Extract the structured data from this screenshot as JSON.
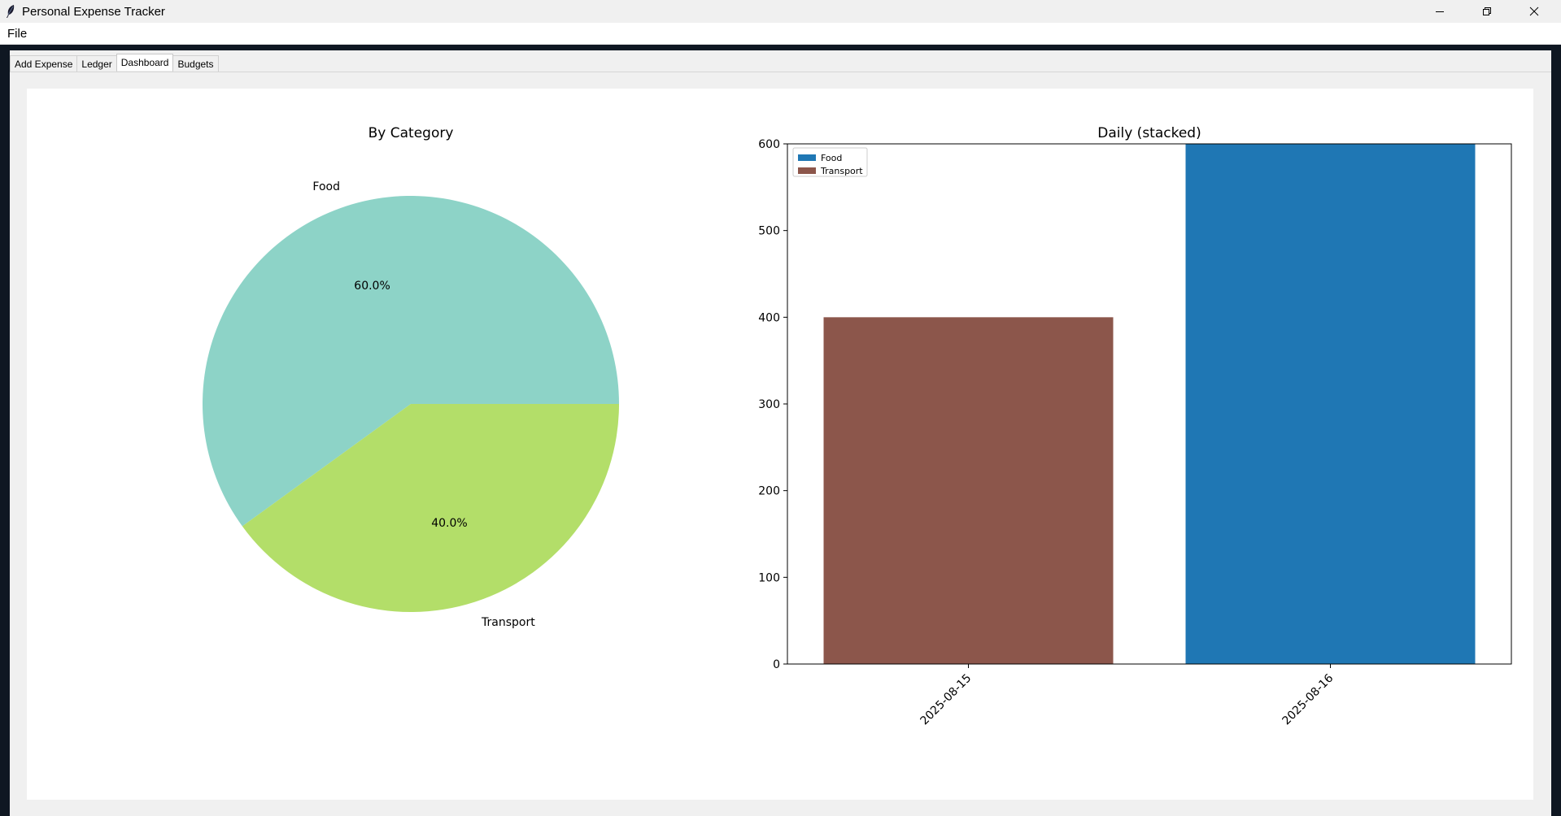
{
  "window": {
    "title": "Personal Expense Tracker"
  },
  "menu": {
    "file_label": "File"
  },
  "tabs": [
    {
      "label": "Add Expense"
    },
    {
      "label": "Ledger"
    },
    {
      "label": "Dashboard"
    },
    {
      "label": "Budgets"
    }
  ],
  "active_tab": "Dashboard",
  "chart_data": [
    {
      "type": "pie",
      "title": "By Category",
      "labels": [
        "Food",
        "Transport"
      ],
      "values": [
        60.0,
        40.0
      ],
      "pct_labels": [
        "60.0%",
        "40.0%"
      ],
      "colors": [
        "#8dd3c7",
        "#b3de69"
      ]
    },
    {
      "type": "bar",
      "stacked": true,
      "title": "Daily (stacked)",
      "categories": [
        "2025-08-15",
        "2025-08-16"
      ],
      "series": [
        {
          "name": "Food",
          "values": [
            0,
            600
          ],
          "color": "#1f77b4"
        },
        {
          "name": "Transport",
          "values": [
            400,
            0
          ],
          "color": "#8c564b"
        }
      ],
      "ylim": [
        0,
        600
      ],
      "yticks": [
        "0",
        "100",
        "200",
        "300",
        "400",
        "500",
        "600"
      ],
      "legend": "top-left"
    }
  ]
}
